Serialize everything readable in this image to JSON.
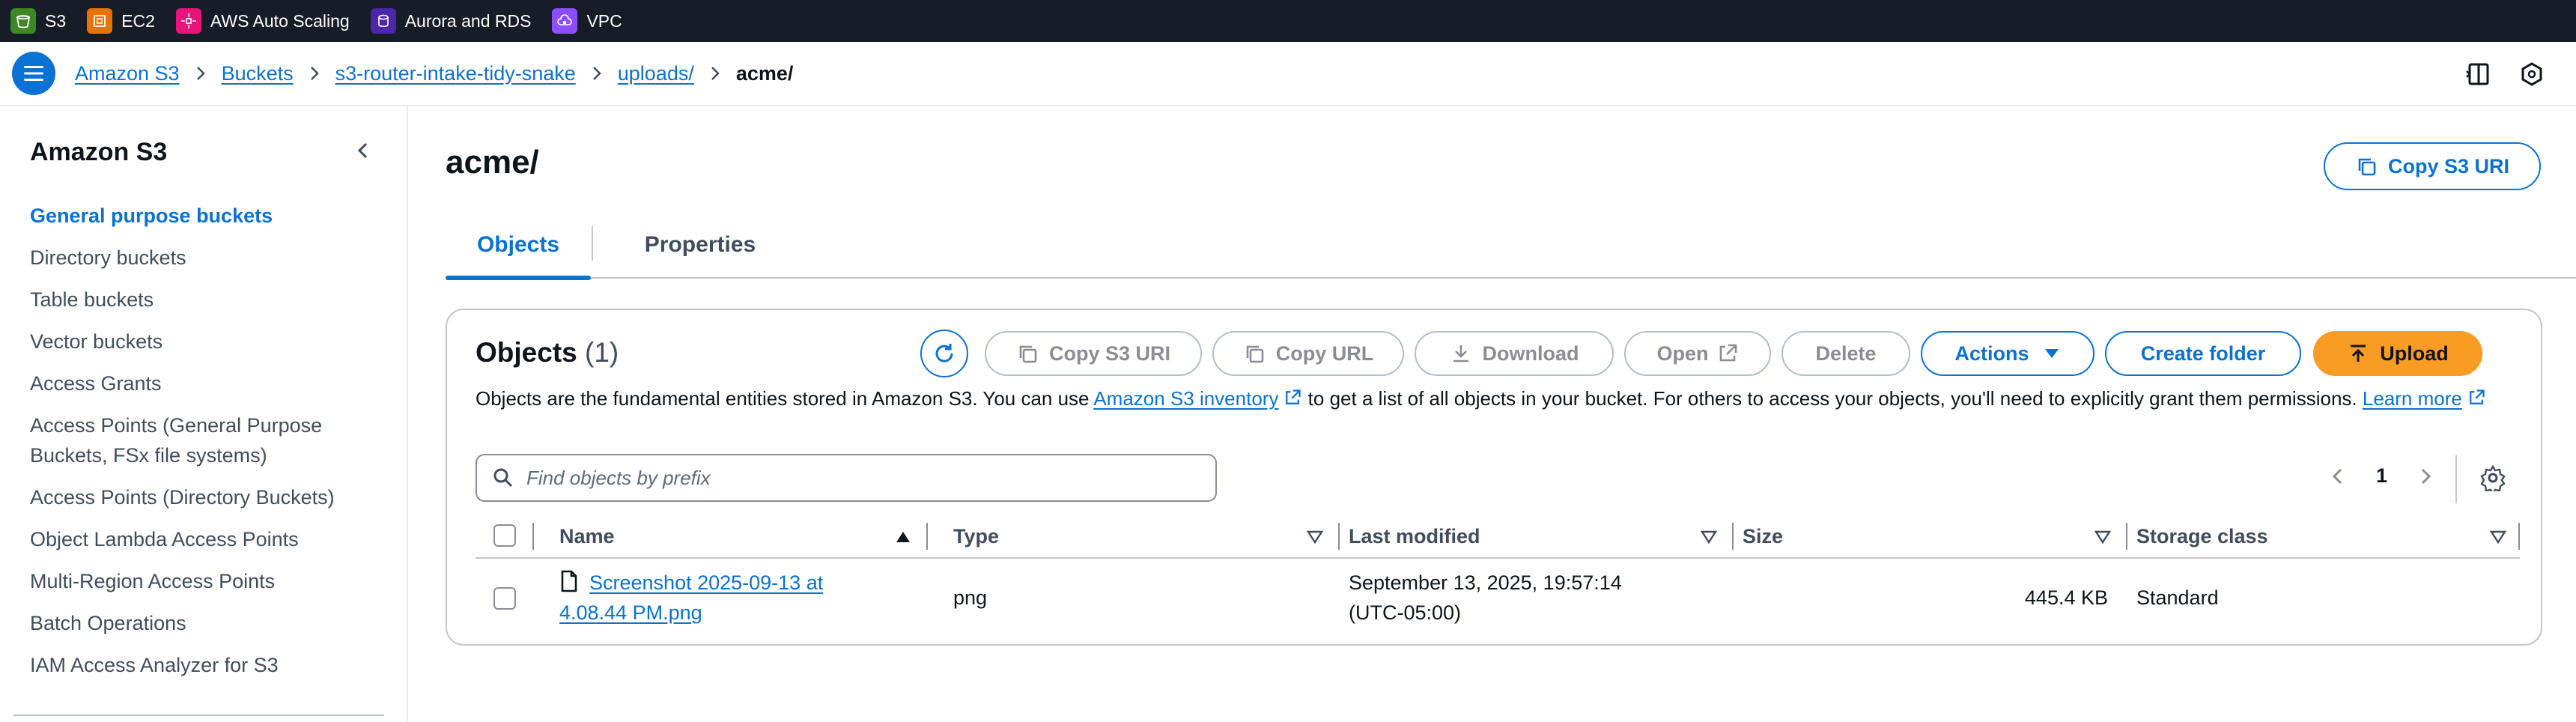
{
  "favorites": [
    {
      "label": "S3",
      "icon": "s3-icon",
      "color": "#3f8624"
    },
    {
      "label": "EC2",
      "icon": "ec2-icon",
      "color": "#ed7100"
    },
    {
      "label": "AWS Auto Scaling",
      "icon": "auto-scaling-icon",
      "color": "#e7157b"
    },
    {
      "label": "Aurora and RDS",
      "icon": "rds-icon",
      "color": "#4d27aa"
    },
    {
      "label": "VPC",
      "icon": "vpc-icon",
      "color": "#8c4fff"
    }
  ],
  "breadcrumb": {
    "items": [
      "Amazon S3",
      "Buckets",
      "s3-router-intake-tidy-snake",
      "uploads/"
    ],
    "current": "acme/"
  },
  "sidebar": {
    "title": "Amazon S3",
    "items": [
      {
        "label": "General purpose buckets",
        "active": true
      },
      {
        "label": "Directory buckets"
      },
      {
        "label": "Table buckets"
      },
      {
        "label": "Vector buckets"
      },
      {
        "label": "Access Grants"
      },
      {
        "label": "Access Points (General Purpose Buckets, FSx file systems)"
      },
      {
        "label": "Access Points (Directory Buckets)"
      },
      {
        "label": "Object Lambda Access Points"
      },
      {
        "label": "Multi-Region Access Points"
      },
      {
        "label": "Batch Operations"
      },
      {
        "label": "IAM Access Analyzer for S3"
      }
    ]
  },
  "main": {
    "title": "acme/",
    "copy_uri_label": "Copy S3 URI",
    "tabs": [
      "Objects",
      "Properties"
    ]
  },
  "objects": {
    "title": "Objects",
    "count": "(1)",
    "buttons": {
      "copy_uri": "Copy S3 URI",
      "copy_url": "Copy URL",
      "download": "Download",
      "open": "Open",
      "delete": "Delete",
      "actions": "Actions",
      "create_folder": "Create folder",
      "upload": "Upload"
    },
    "desc_1": "Objects are the fundamental entities stored in Amazon S3. You can use ",
    "desc_link_1": "Amazon S3 inventory",
    "desc_2": " to get a list of all objects in your bucket. For others to access your objects, you'll need to explicitly grant them permissions. ",
    "desc_link_2": "Learn more",
    "search_placeholder": "Find objects by prefix",
    "page": "1",
    "columns": [
      "Name",
      "Type",
      "Last modified",
      "Size",
      "Storage class"
    ],
    "rows": [
      {
        "name": "Screenshot 2025-09-13 at 4.08.44 PM.png",
        "type": "png",
        "last_modified_1": "September 13, 2025, 19:57:14",
        "last_modified_2": "(UTC-05:00)",
        "size": "445.4 KB",
        "storage_class": "Standard"
      }
    ]
  },
  "colors": {
    "accent": "#0972d3",
    "upload": "#f89c24",
    "topbar": "#161d26"
  }
}
